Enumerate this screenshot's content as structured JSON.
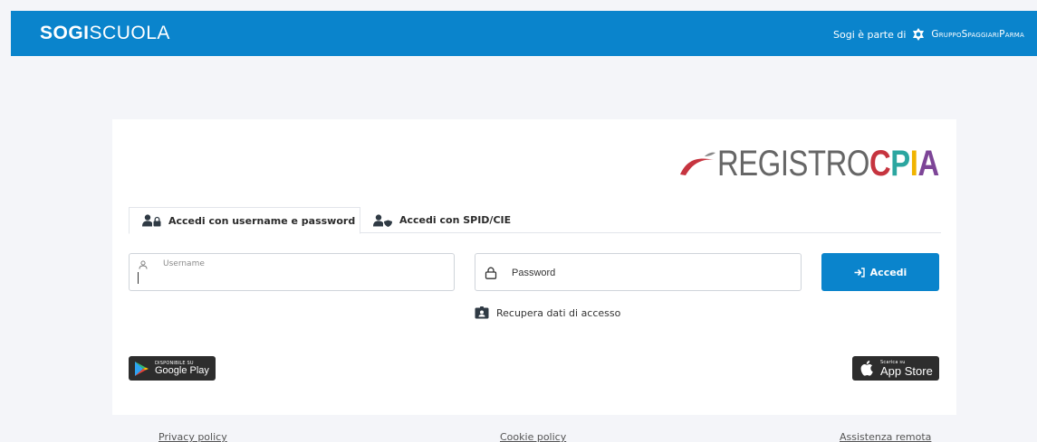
{
  "header": {
    "brand_bold": "SOGI",
    "brand_light": "SCUOLA",
    "part_of_text": "Sogi è parte di",
    "group_name": "GruppoSpaggiariParma",
    "background_color": "#0a84cc"
  },
  "logo": {
    "text_main": "REGISTRO",
    "text_accent": [
      "C",
      "P",
      "I",
      "A"
    ],
    "accent_colors": [
      "#c6343f",
      "#2ba6a0",
      "#f0b400",
      "#7d4597"
    ]
  },
  "tabs": [
    {
      "label": "Accedi con username e password",
      "icon": "user-lock-icon",
      "active": true
    },
    {
      "label": "Accedi con SPID/CIE",
      "icon": "user-shield-icon",
      "active": false
    }
  ],
  "form": {
    "username_label": "Username",
    "username_value": "",
    "password_placeholder": "Password",
    "password_value": "",
    "submit_label": "Accedi",
    "recover_label": "Recupera dati di accesso"
  },
  "stores": {
    "google_play_small": "DISPONIBILE SU",
    "google_play_big": "Google Play",
    "app_store_small": "Scarica su",
    "app_store_big": "App Store"
  },
  "footer": {
    "privacy": "Privacy policy",
    "cookie": "Cookie policy",
    "assistance": "Assistenza remota"
  },
  "colors": {
    "primary": "#0a84cc",
    "page_background": "#f4f5f9"
  }
}
